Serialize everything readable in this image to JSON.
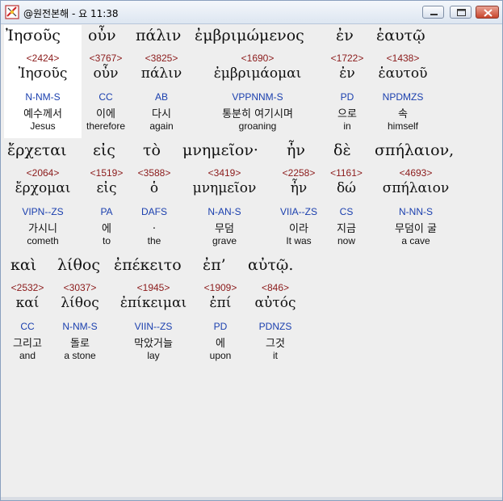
{
  "window": {
    "title": "@원전본해 - 요 11:38",
    "icon": "app-logo-icon",
    "controls": [
      "minimize-icon",
      "maximize-icon",
      "close-icon"
    ]
  },
  "words": [
    {
      "greek": "Ἰησοῦς",
      "strong": "<2424>",
      "lemma": "Ἰησοῦς",
      "morph": "N-NM-S",
      "korean": "예수께서",
      "english": "Jesus"
    },
    {
      "greek": "οὖν",
      "strong": "<3767>",
      "lemma": "οὖν",
      "morph": "CC",
      "korean": "이에",
      "english": "therefore"
    },
    {
      "greek": "πάλιν",
      "strong": "<3825>",
      "lemma": "πάλιν",
      "morph": "AB",
      "korean": "다시",
      "english": "again"
    },
    {
      "greek": "ἐμβριμώμενος",
      "strong": "<1690>",
      "lemma": "ἐμβριμάομαι",
      "morph": "VPPNNM-S",
      "korean": "통분히 여기시며",
      "english": "groaning"
    },
    {
      "greek": "ἐν",
      "strong": "<1722>",
      "lemma": "ἐν",
      "morph": "PD",
      "korean": "으로",
      "english": "in"
    },
    {
      "greek": "ἑαυτῷ",
      "strong": "<1438>",
      "lemma": "ἑαυτοῦ",
      "morph": "NPDMZS",
      "korean": "속",
      "english": "himself"
    },
    {
      "greek": "ἔρχεται",
      "strong": "<2064>",
      "lemma": "ἔρχομαι",
      "morph": "VIPN--ZS",
      "korean": "가시니",
      "english": "cometh"
    },
    {
      "greek": "εἰς",
      "strong": "<1519>",
      "lemma": "εἰς",
      "morph": "PA",
      "korean": "에",
      "english": "to"
    },
    {
      "greek": "τὸ",
      "strong": "<3588>",
      "lemma": "ὁ",
      "morph": "DAFS",
      "korean": ".",
      "english": "the"
    },
    {
      "greek": "μνημεῖον·",
      "strong": "<3419>",
      "lemma": "μνημεῖον",
      "morph": "N-AN-S",
      "korean": "무덤",
      "english": "grave"
    },
    {
      "greek": "ἦν",
      "strong": "<2258>",
      "lemma": "ἦν",
      "morph": "VIIA--ZS",
      "korean": "이라",
      "english": "It was"
    },
    {
      "greek": "δὲ",
      "strong": "<1161>",
      "lemma": "δώ",
      "morph": "CS",
      "korean": "지금",
      "english": "now"
    },
    {
      "greek": "σπήλαιον,",
      "strong": "<4693>",
      "lemma": "σπήλαιον",
      "morph": "N-NN-S",
      "korean": "무덤이 굴",
      "english": "a cave"
    },
    {
      "greek": "καὶ",
      "strong": "<2532>",
      "lemma": "καί",
      "morph": "CC",
      "korean": "그리고",
      "english": "and"
    },
    {
      "greek": "λίθος",
      "strong": "<3037>",
      "lemma": "λίθος",
      "morph": "N-NM-S",
      "korean": "돌로",
      "english": "a stone"
    },
    {
      "greek": "ἐπέκειτο",
      "strong": "<1945>",
      "lemma": "ἐπίκειμαι",
      "morph": "VIIN--ZS",
      "korean": "막았거늘",
      "english": "lay"
    },
    {
      "greek": "ἐπ’",
      "strong": "<1909>",
      "lemma": "ἐπί",
      "morph": "PD",
      "korean": "에",
      "english": "upon"
    },
    {
      "greek": "αὐτῷ.",
      "strong": "<846>",
      "lemma": "αὐτός",
      "morph": "PDNZS",
      "korean": "그것",
      "english": "it"
    }
  ]
}
